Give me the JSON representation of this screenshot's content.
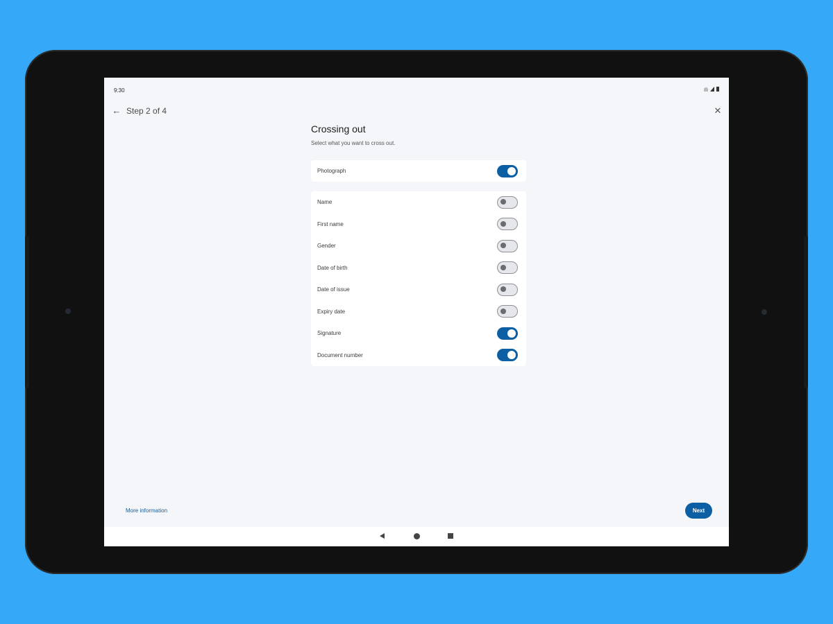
{
  "status_bar": {
    "time": "9:30"
  },
  "header": {
    "back_icon": "arrow-left-icon",
    "step_label": "Step 2 of 4",
    "close_icon": "close-icon"
  },
  "content": {
    "title": "Crossing out",
    "subtitle": "Select what you want to cross out."
  },
  "photo_option": {
    "label": "Photograph",
    "checked": true
  },
  "field_options": [
    {
      "label": "Name",
      "checked": false
    },
    {
      "label": "First name",
      "checked": false
    },
    {
      "label": "Gender",
      "checked": false
    },
    {
      "label": "Date of birth",
      "checked": false
    },
    {
      "label": "Date of issue",
      "checked": false
    },
    {
      "label": "Expiry date",
      "checked": false
    },
    {
      "label": "Signature",
      "checked": true
    },
    {
      "label": "Document number",
      "checked": true
    }
  ],
  "footer": {
    "more_info_label": "More information",
    "next_label": "Next"
  },
  "colors": {
    "background": "#35a9f8",
    "accent": "#0d5fa3",
    "screen": "#f4f6fa"
  }
}
